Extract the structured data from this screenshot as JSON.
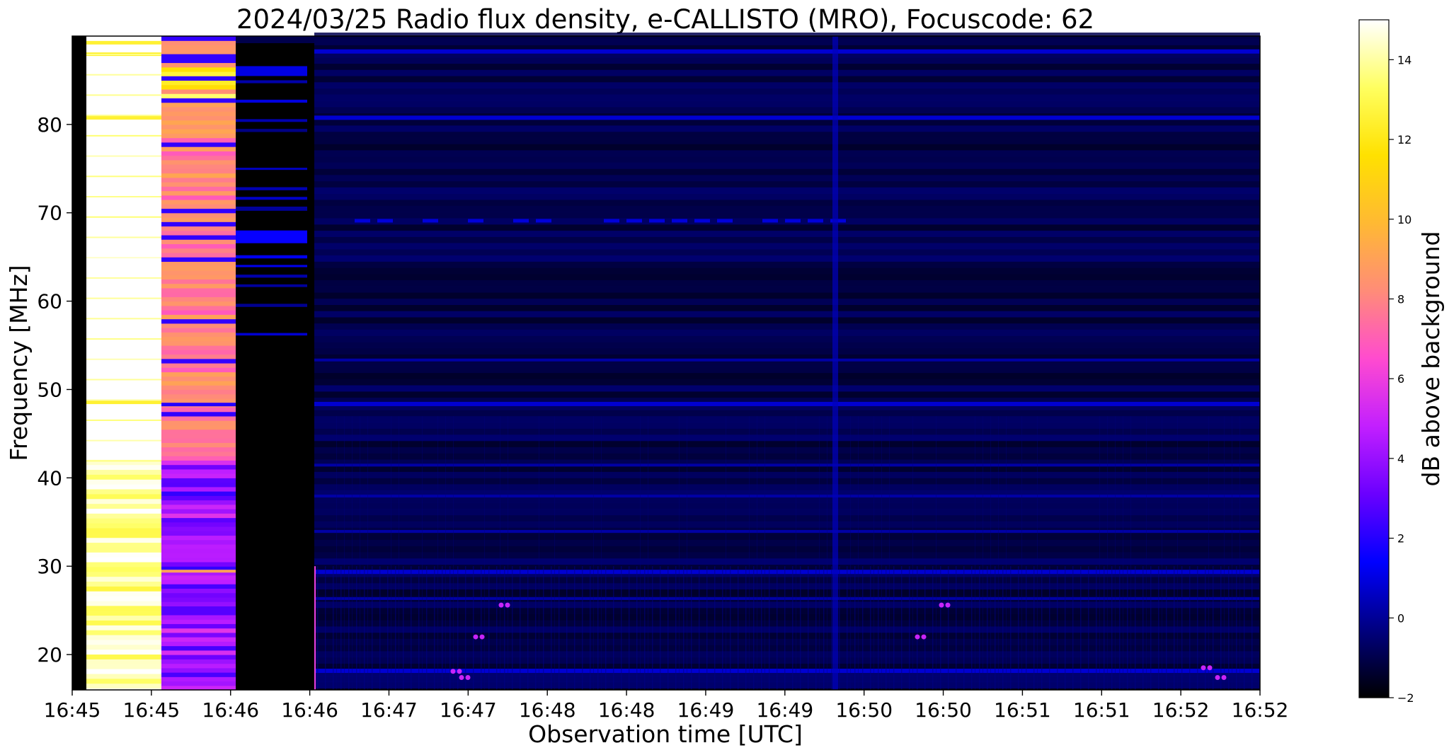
{
  "chart_data": {
    "type": "heatmap",
    "title": "2024/03/25  Radio flux density, e-CALLISTO (MRO), Focuscode: 62",
    "xlabel": "Observation time [UTC]",
    "ylabel": "Frequency [MHz]",
    "colorbar_label": "dB above background",
    "colormap": "gnuplot2",
    "x_tick_labels": [
      "16:45",
      "16:45",
      "16:46",
      "16:46",
      "16:47",
      "16:47",
      "16:48",
      "16:48",
      "16:49",
      "16:49",
      "16:50",
      "16:50",
      "16:51",
      "16:51",
      "16:52",
      "16:52"
    ],
    "y_ticks": [
      20,
      30,
      40,
      50,
      60,
      70,
      80
    ],
    "ylim": [
      16,
      90
    ],
    "colorbar_ticks": [
      -2,
      0,
      2,
      4,
      6,
      8,
      10,
      12,
      14
    ],
    "clim": [
      -2,
      15
    ],
    "colors": [
      "#000000",
      "#000080",
      "#0000ff",
      "#6a00ff",
      "#c21fff",
      "#ff4bcf",
      "#ff8c78",
      "#ffb933",
      "#ffe100",
      "#ffff60",
      "#ffffff"
    ],
    "segments": [
      {
        "time_range": "16:45:00-16:45:05",
        "description_level_db": -1.5
      },
      {
        "time_range": "16:45:05-16:45:30",
        "level_db": 14,
        "upper_band_level_db": 15,
        "lower_band_level_db": 13
      },
      {
        "time_range": "16:45:30-16:45:55",
        "level_db": 7,
        "upper_band_level_db": 9,
        "lower_band_level_db": 3
      },
      {
        "time_range": "16:45:55-16:46:20",
        "level_db": -1.5,
        "upper_band_level_db": 0.5
      },
      {
        "time_range": "16:46:20-16:52:00",
        "level_db": -0.8
      }
    ]
  }
}
